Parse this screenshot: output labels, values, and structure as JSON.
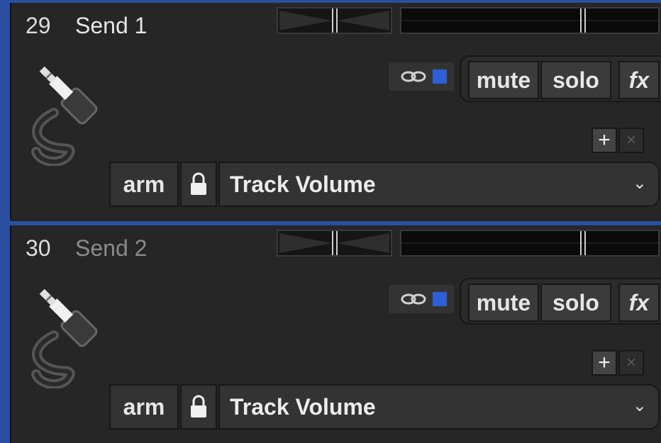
{
  "tracks": [
    {
      "number": "29",
      "name": "Send 1",
      "name_color": "#e6e6e6",
      "buttons": {
        "mute": "mute",
        "solo": "solo",
        "fx": "fx",
        "add": "+",
        "remove": "×",
        "arm": "arm"
      },
      "dropdown": {
        "selected": "Track Volume"
      },
      "icons": {
        "track": "audio-cable-icon",
        "link": "link-icon",
        "lock": "lock-icon",
        "chevron": "chevron-down-icon"
      }
    },
    {
      "number": "30",
      "name": "Send 2",
      "name_color": "#8a8a8a",
      "buttons": {
        "mute": "mute",
        "solo": "solo",
        "fx": "fx",
        "add": "+",
        "remove": "×",
        "arm": "arm"
      },
      "dropdown": {
        "selected": "Track Volume"
      },
      "icons": {
        "track": "audio-cable-icon",
        "link": "link-icon",
        "lock": "lock-icon",
        "chevron": "chevron-down-icon"
      }
    }
  ],
  "colors": {
    "accent": "#2a4fa0",
    "selector": "#2f5fd8"
  }
}
